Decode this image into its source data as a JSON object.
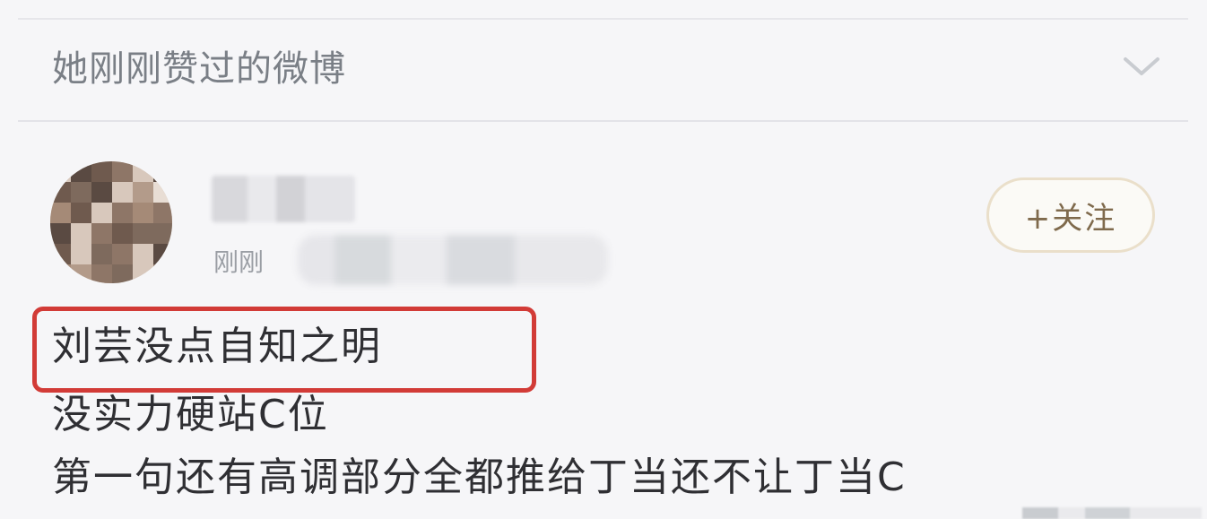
{
  "section": {
    "title": "她刚刚赞过的微博",
    "collapse_icon": "chevron-down-icon"
  },
  "post": {
    "time": "刚刚",
    "follow_label": "+关注",
    "lines": [
      "刘芸没点自知之明",
      "没实力硬站C位",
      "第一句还有高调部分全都推给丁当还不让丁当C"
    ]
  },
  "colors": {
    "background": "#f6f6f8",
    "highlight": "#d23b37",
    "follow_border": "#eadfca",
    "follow_text": "#7f6a4c"
  }
}
